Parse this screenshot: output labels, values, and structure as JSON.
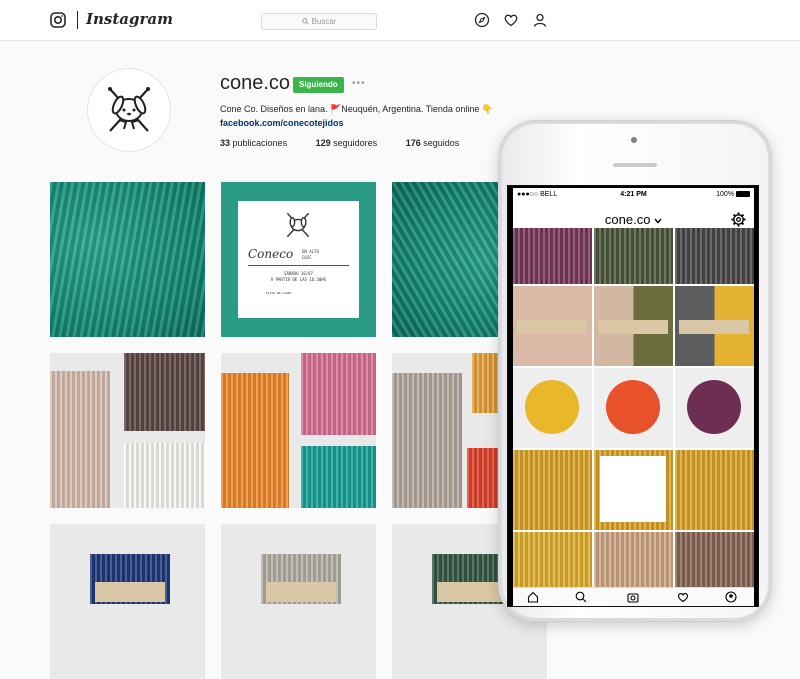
{
  "header": {
    "brand": "Instagram",
    "search_placeholder": "Buscar"
  },
  "profile": {
    "username": "cone.co",
    "follow_label": "Siguiendo",
    "more_label": "•••",
    "bio": "Cone Co. Diseños en lana. 🚩Neuquén, Argentina. Tienda online 👇",
    "link": "facebook.com/conecotejidos",
    "stats": [
      {
        "count": "33",
        "label": "publicaciones"
      },
      {
        "count": "129",
        "label": "seguidores"
      },
      {
        "count": "176",
        "label": "seguidos"
      }
    ]
  },
  "post_card": {
    "logo": "Coneco",
    "tagline": "EN ALTO\nCHIC",
    "event": "SÁBADO 16/07\nA PARTIR DE LAS 16:30HS",
    "footer": "ELITA UN LUGAR"
  },
  "mobile": {
    "carrier": "●●●○○ BELL",
    "time": "4:21 PM",
    "battery": "100%",
    "title": "cone.co"
  },
  "colors": {
    "accent_follow": "#3bb54a",
    "link": "#003569",
    "teal_wool": "#138c75"
  }
}
